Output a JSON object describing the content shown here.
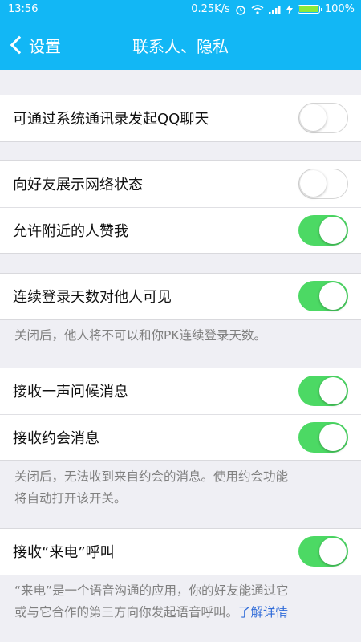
{
  "status_bar": {
    "time": "13:56",
    "net_speed": "0.25K/s",
    "battery": "100%",
    "icons": [
      "alarm-icon",
      "wifi-icon",
      "signal-icon",
      "charging-icon",
      "battery-icon"
    ]
  },
  "nav": {
    "back_label": "设置",
    "title": "联系人、隐私"
  },
  "colors": {
    "bar": "#12b7f5",
    "toggle_on": "#4cd964",
    "link": "#2f6bd8"
  },
  "settings": {
    "contacts_qq": {
      "label": "可通过系统通讯录发起QQ聊天",
      "on": false
    },
    "online_status": {
      "label": "向好友展示网络状态",
      "on": false
    },
    "nearby_like": {
      "label": "允许附近的人赞我",
      "on": true
    },
    "login_days": {
      "label": "连续登录天数对他人可见",
      "on": true
    },
    "login_days_note": "关闭后，他人将不可以和你PK连续登录天数。",
    "greeting": {
      "label": "接收一声问候消息",
      "on": true
    },
    "date_msg": {
      "label": "接收约会消息",
      "on": true
    },
    "date_note_1": "关闭后，无法收到来自约会的消息。使用约会功能",
    "date_note_2": "将自动打开该开关。",
    "incoming_call": {
      "label": "接收“来电”呼叫",
      "on": true
    },
    "call_note_1": "“来电”是一个语音沟通的应用，你的好友能通过它",
    "call_note_2": "或与它合作的第三方向你发起语音呼叫。",
    "call_note_link": "了解详情"
  }
}
